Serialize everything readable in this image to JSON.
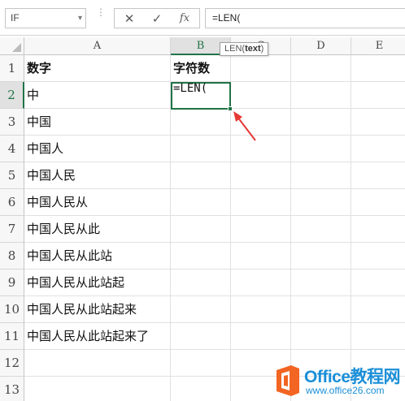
{
  "formula_bar": {
    "name_box": "IF",
    "name_box_dropdown": "▾",
    "cancel_symbol": "✕",
    "enter_symbol": "✓",
    "fx_symbol": "fx",
    "formula": "=LEN("
  },
  "tooltip": {
    "func": "LEN(",
    "arg": "text",
    "close": ")"
  },
  "columns": [
    "A",
    "B",
    "C",
    "D",
    "E"
  ],
  "active_column": "B",
  "rows": [
    {
      "num": "1",
      "a": "数字",
      "b": "字符数"
    },
    {
      "num": "2",
      "a": "中",
      "b": "=LEN("
    },
    {
      "num": "3",
      "a": "中国",
      "b": ""
    },
    {
      "num": "4",
      "a": "中国人",
      "b": ""
    },
    {
      "num": "5",
      "a": "中国人民",
      "b": ""
    },
    {
      "num": "6",
      "a": "中国人民从",
      "b": ""
    },
    {
      "num": "7",
      "a": "中国人民从此",
      "b": ""
    },
    {
      "num": "8",
      "a": "中国人民从此站",
      "b": ""
    },
    {
      "num": "9",
      "a": "中国人民从此站起",
      "b": ""
    },
    {
      "num": "10",
      "a": "中国人民从此站起来",
      "b": ""
    },
    {
      "num": "11",
      "a": "中国人民从此站起来了",
      "b": ""
    },
    {
      "num": "12",
      "a": "",
      "b": ""
    },
    {
      "num": "13",
      "a": "",
      "b": ""
    }
  ],
  "active_row": "2",
  "icons": {
    "name_box_dropdown": "chevron-down-icon",
    "cancel": "close-icon",
    "enter": "check-icon",
    "fx": "function-icon",
    "annotation_arrow": "red-arrow-icon",
    "logo": "office-logo-icon"
  },
  "logo": {
    "title": "Office教程网",
    "url": "www.office26.com"
  },
  "colors": {
    "accent_green": "#217346",
    "arrow_red": "#e53935",
    "logo_orange": "#f26522",
    "logo_blue": "#1a8fd8"
  }
}
